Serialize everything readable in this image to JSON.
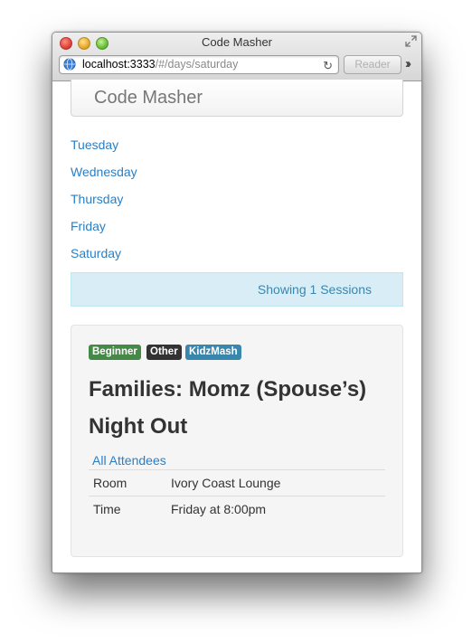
{
  "window": {
    "title": "Code Masher"
  },
  "addressbar": {
    "host": "localhost:3333",
    "path": "/#/days/saturday",
    "reader_label": "Reader"
  },
  "navbar": {
    "brand": "Code Masher"
  },
  "days": [
    "Tuesday",
    "Wednesday",
    "Thursday",
    "Friday",
    "Saturday"
  ],
  "alert": {
    "text": "Showing 1 Sessions"
  },
  "session": {
    "badges": [
      "Beginner",
      "Other",
      "KidzMash"
    ],
    "title": "Families: Momz (Spouse’s) Night Out",
    "attendees_link": "All Attendees",
    "rows": [
      {
        "label": "Room",
        "value": "Ivory Coast Lounge"
      },
      {
        "label": "Time",
        "value": "Friday at 8:00pm"
      }
    ]
  },
  "colors": {
    "link": "#2a7fc4",
    "alert_bg": "#d9edf7",
    "badge_success": "#468847",
    "badge_inverse": "#333333",
    "badge_info": "#3a87ad"
  }
}
